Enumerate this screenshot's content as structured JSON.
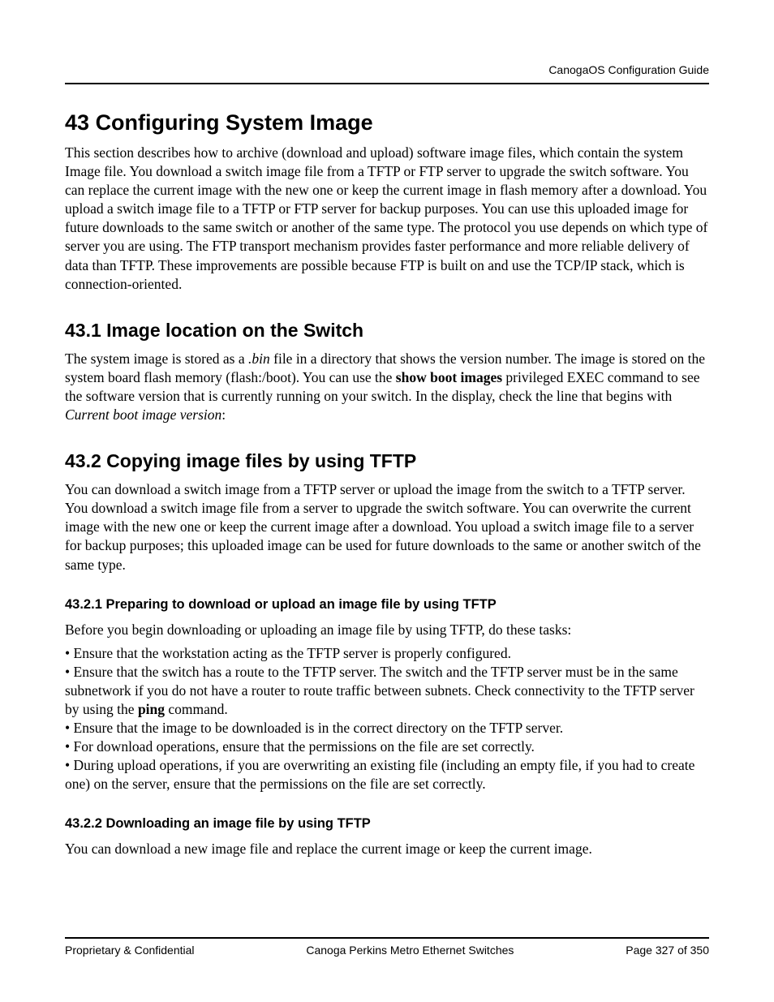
{
  "header": {
    "doc_title": "CanogaOS Configuration Guide"
  },
  "h1": {
    "num": "43",
    "title": "Configuring System Image"
  },
  "intro": {
    "p1": "This section describes how to archive (download and upload) software image files, which contain the system Image file. You download a switch image file from a TFTP or FTP server to upgrade the switch software. You can replace the current image with the new one or keep the current image in flash memory after a download. You upload a switch image file to a TFTP or FTP server for backup purposes. You can use this uploaded image for future downloads to the same switch or another of the same type. The protocol you use depends on which type of server you are using. The FTP transport mechanism provides faster performance and more reliable delivery of data than TFTP. These improvements are possible because FTP is built on and use the TCP/IP stack, which is connection-oriented."
  },
  "s431": {
    "heading": "43.1  Image location on the Switch",
    "t1": "The system image is stored as a ",
    "bin": ".bin",
    "t2": " file in a directory that shows the version number. The image is stored on the system board flash memory (flash:/boot). You can use the ",
    "cmd": "show boot images",
    "t3": " privileged EXEC command to see the software version that is currently running on your switch. In the display, check the line that begins with ",
    "cbv": "Current boot image version",
    "t4": ":"
  },
  "s432": {
    "heading": "43.2  Copying image files by using TFTP",
    "p1": "You can download a switch image from a TFTP server or upload the image from the switch to a TFTP server. You download a switch image file from a server to upgrade the switch software. You can overwrite the current image with the new one or keep the current image after a download. You upload a switch image file to a server for backup purposes; this uploaded image can be used for future downloads to the same or another switch of the same type."
  },
  "s4321": {
    "heading": "43.2.1 Preparing to download or upload an image file by using TFTP",
    "lead": "Before you begin downloading or uploading an image file by using TFTP, do these tasks:",
    "b1": "• Ensure that the workstation acting as the TFTP server is properly configured.",
    "b2a": "• Ensure that the switch has a route to the TFTP server. The switch and the TFTP server must be in the same subnetwork if you do not have a router to route traffic between subnets. Check connectivity to the TFTP server by using the ",
    "ping": "ping",
    "b2b": " command.",
    "b3": "• Ensure that the image to be downloaded is in the correct directory on the TFTP server.",
    "b4": "• For download operations, ensure that the permissions on the file are set correctly.",
    "b5": "• During upload operations, if you are overwriting an existing file (including an empty file, if you had to create one) on the server, ensure that the permissions on the file are set correctly."
  },
  "s4322": {
    "heading": "43.2.2 Downloading an image file by using TFTP",
    "p1": "You can download a new image file and replace the current image or keep the current image."
  },
  "footer": {
    "left": "Proprietary & Confidential",
    "center": "Canoga Perkins Metro Ethernet Switches",
    "right": "Page 327 of 350"
  }
}
